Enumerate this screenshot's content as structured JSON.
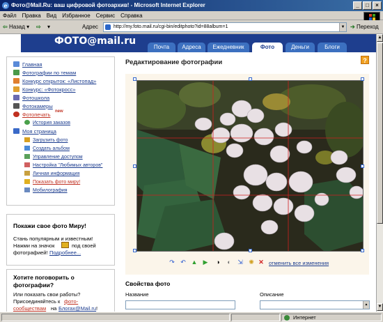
{
  "window": {
    "title": "Фото@Mail.Ru: ваш цифровой фотоархив! - Microsoft Internet Explorer"
  },
  "menu": [
    "Файл",
    "Правка",
    "Вид",
    "Избранное",
    "Сервис",
    "Справка"
  ],
  "toolbar": {
    "back": "Назад",
    "address_label": "Адрес",
    "url": "http://my.foto.mail.ru/cgi-bin/editphoto?id=88album=1",
    "go": "Переход"
  },
  "site": {
    "logo": "ФОТО@mail.ru",
    "tabs": [
      "Почта",
      "Адреса",
      "Ежедневник",
      "Фото",
      "Деньги",
      "Блоги"
    ],
    "active_tab": "Фото"
  },
  "sidebar": {
    "nav": [
      "Главная",
      "Фотографии по темам",
      "Конкурс открыток: «Листопад»",
      "Конкурс: «Фотокросс»",
      "Фотошкола",
      "Фотокамеры",
      "Фотопечать",
      "История заказов",
      "Моя страница"
    ],
    "new_badge": "new",
    "my_page_items": [
      "Загрузить фото",
      "Создать альбом",
      "Управление доступом",
      "Настройка \"Любимых авторов\"",
      "Личная информация",
      "Показать фото миру!",
      "Мобилография"
    ],
    "promo1": {
      "title": "Покажи свое фото Миру!",
      "line1": "Стань популярным и известным!",
      "line2": "Нажми на значок",
      "line3": "под своей",
      "line4": "фотографией!",
      "link": "Подробнее..."
    },
    "promo2": {
      "title1": "Хотите поговорить о",
      "title2": "фотографии?",
      "line1": "Или показать свои работы?",
      "line2": "Присоединяйтесь к",
      "link1": "фото-",
      "link1b": "сообществам",
      "on": "на",
      "link2": "Блогах@Mail.ru",
      "end": "!"
    }
  },
  "main": {
    "title": "Редактирование фотографии",
    "help": "?",
    "cancel_all": "отменить все изменения",
    "props_title": "Свойства фото",
    "name_label": "Название",
    "desc_label": "Описание"
  },
  "status": {
    "zone": "Интернет"
  }
}
